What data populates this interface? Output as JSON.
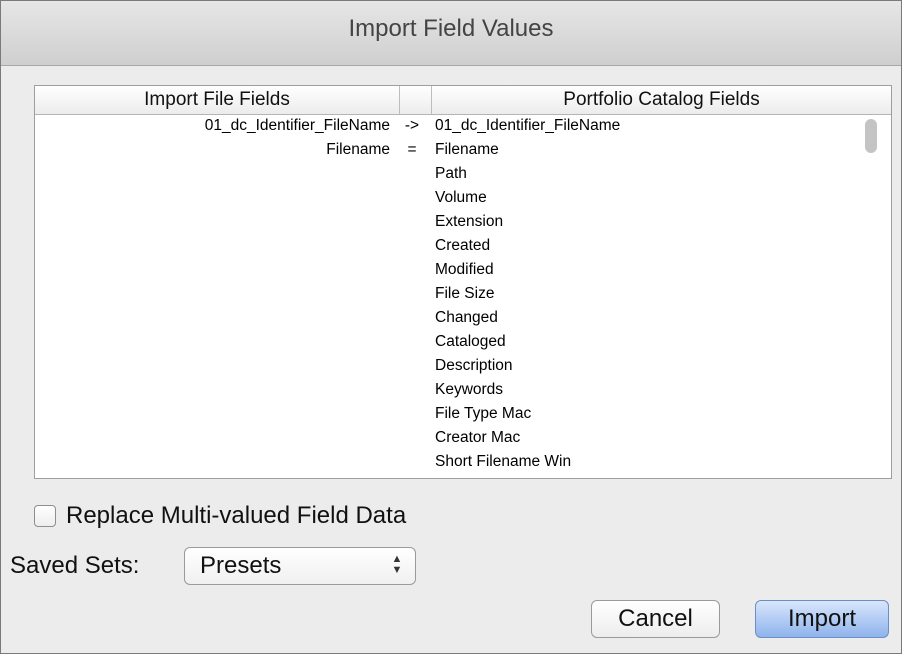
{
  "window": {
    "title": "Import Field Values"
  },
  "table": {
    "headers": [
      "Import File Fields",
      "",
      "Portfolio Catalog Fields"
    ],
    "rows": [
      {
        "source": "01_dc_Identifier_FileName",
        "op": "->",
        "target": "01_dc_Identifier_FileName"
      },
      {
        "source": "Filename",
        "op": "=",
        "target": "Filename"
      },
      {
        "source": "",
        "op": "",
        "target": "Path"
      },
      {
        "source": "",
        "op": "",
        "target": "Volume"
      },
      {
        "source": "",
        "op": "",
        "target": "Extension"
      },
      {
        "source": "",
        "op": "",
        "target": "Created"
      },
      {
        "source": "",
        "op": "",
        "target": "Modified"
      },
      {
        "source": "",
        "op": "",
        "target": "File Size"
      },
      {
        "source": "",
        "op": "",
        "target": "Changed"
      },
      {
        "source": "",
        "op": "",
        "target": "Cataloged"
      },
      {
        "source": "",
        "op": "",
        "target": "Description"
      },
      {
        "source": "",
        "op": "",
        "target": "Keywords"
      },
      {
        "source": "",
        "op": "",
        "target": "File Type Mac"
      },
      {
        "source": "",
        "op": "",
        "target": "Creator Mac"
      },
      {
        "source": "",
        "op": "",
        "target": "Short Filename Win"
      }
    ]
  },
  "options": {
    "replace_multi_label": "Replace Multi-valued Field Data",
    "replace_multi_checked": false
  },
  "saved_sets": {
    "label": "Saved Sets:",
    "selected": "Presets"
  },
  "buttons": {
    "cancel": "Cancel",
    "import": "Import"
  }
}
